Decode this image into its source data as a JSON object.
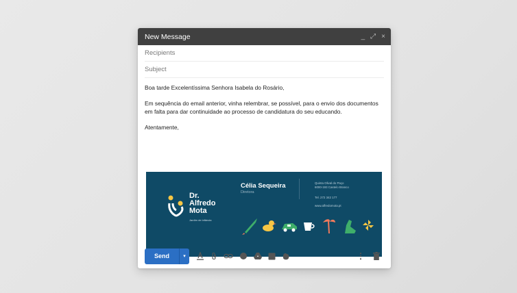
{
  "window": {
    "title": "New Message",
    "controls": {
      "minimize": "_",
      "expand": "⤢",
      "close": "×"
    }
  },
  "fields": {
    "recipients_placeholder": "Recipients",
    "subject_placeholder": "Subject"
  },
  "body": {
    "greeting": "Boa tarde Excelentíssima Senhora Isabela do Rosário,",
    "paragraph": "Em sequência do email anterior, vinha relembrar, se possível, para o envio dos documentos em falta para dar continuidade ao processo de candidatura do seu educando.",
    "closing": "Atentamente,"
  },
  "signature": {
    "logo_text": [
      "Dr.",
      "Alfredo",
      "Mota"
    ],
    "logo_subtitle": "Jardim de infância",
    "name": "Célia Sequeira",
    "role": "Diretora",
    "address_line1": "Quinta Olival do Paço",
    "address_line2": "6000-193 Castelo Branco",
    "phone": "Tel. 272 342 177",
    "website": "www.alfredomota.pt",
    "colors": {
      "background": "#0f4a66",
      "yellow": "#f6c644",
      "green": "#3fae6a",
      "coral": "#f07a5c"
    }
  },
  "toolbar": {
    "send_label": "Send",
    "send_more": "▾",
    "icons": [
      "format-text-icon",
      "attach-icon",
      "link-icon",
      "emoji-icon",
      "drive-icon",
      "photo-icon",
      "lock-icon"
    ],
    "more_options": "⋮"
  }
}
